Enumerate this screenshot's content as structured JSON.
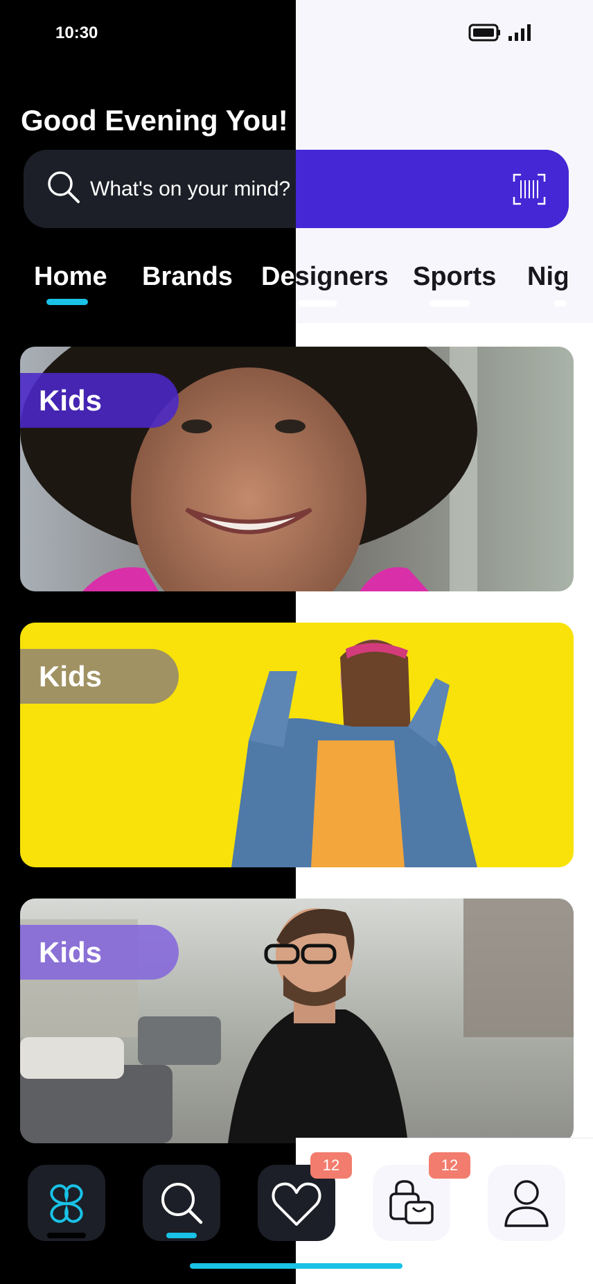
{
  "status_bar": {
    "time": "10:30",
    "battery_icon": "battery-icon",
    "signal_icon": "signal-icon"
  },
  "header": {
    "greeting": "Good Evening You!"
  },
  "search": {
    "placeholder": "What's on your mind?",
    "search_icon": "search-icon",
    "scan_icon": "barcode-scan-icon"
  },
  "tabs": [
    {
      "label": "Home",
      "active": true
    },
    {
      "label": "Brands",
      "active": false
    },
    {
      "label": "Designers",
      "active": false
    },
    {
      "label": "Sports",
      "active": false
    },
    {
      "label": "Nig",
      "active": false
    }
  ],
  "cards": [
    {
      "label": "Kids",
      "image": "smiling-child-curly-hair-photo"
    },
    {
      "label": "Kids",
      "image": "woman-denim-jacket-yellow-wall-photo"
    },
    {
      "label": "Kids",
      "image": "man-glasses-turtleneck-street-photo"
    }
  ],
  "bottom_nav": [
    {
      "icon": "logo-icon",
      "active": true
    },
    {
      "icon": "search-icon",
      "active": false
    },
    {
      "icon": "heart-icon",
      "active": false,
      "badge": "12"
    },
    {
      "icon": "shopping-bag-icon",
      "active": false,
      "badge": "12"
    },
    {
      "icon": "profile-icon",
      "active": false
    }
  ],
  "colors": {
    "accent": "#4527d6",
    "highlight": "#19c2e6",
    "badge": "#f27c6d",
    "dark_bg": "#000000",
    "light_bg": "#f7f6fc"
  }
}
